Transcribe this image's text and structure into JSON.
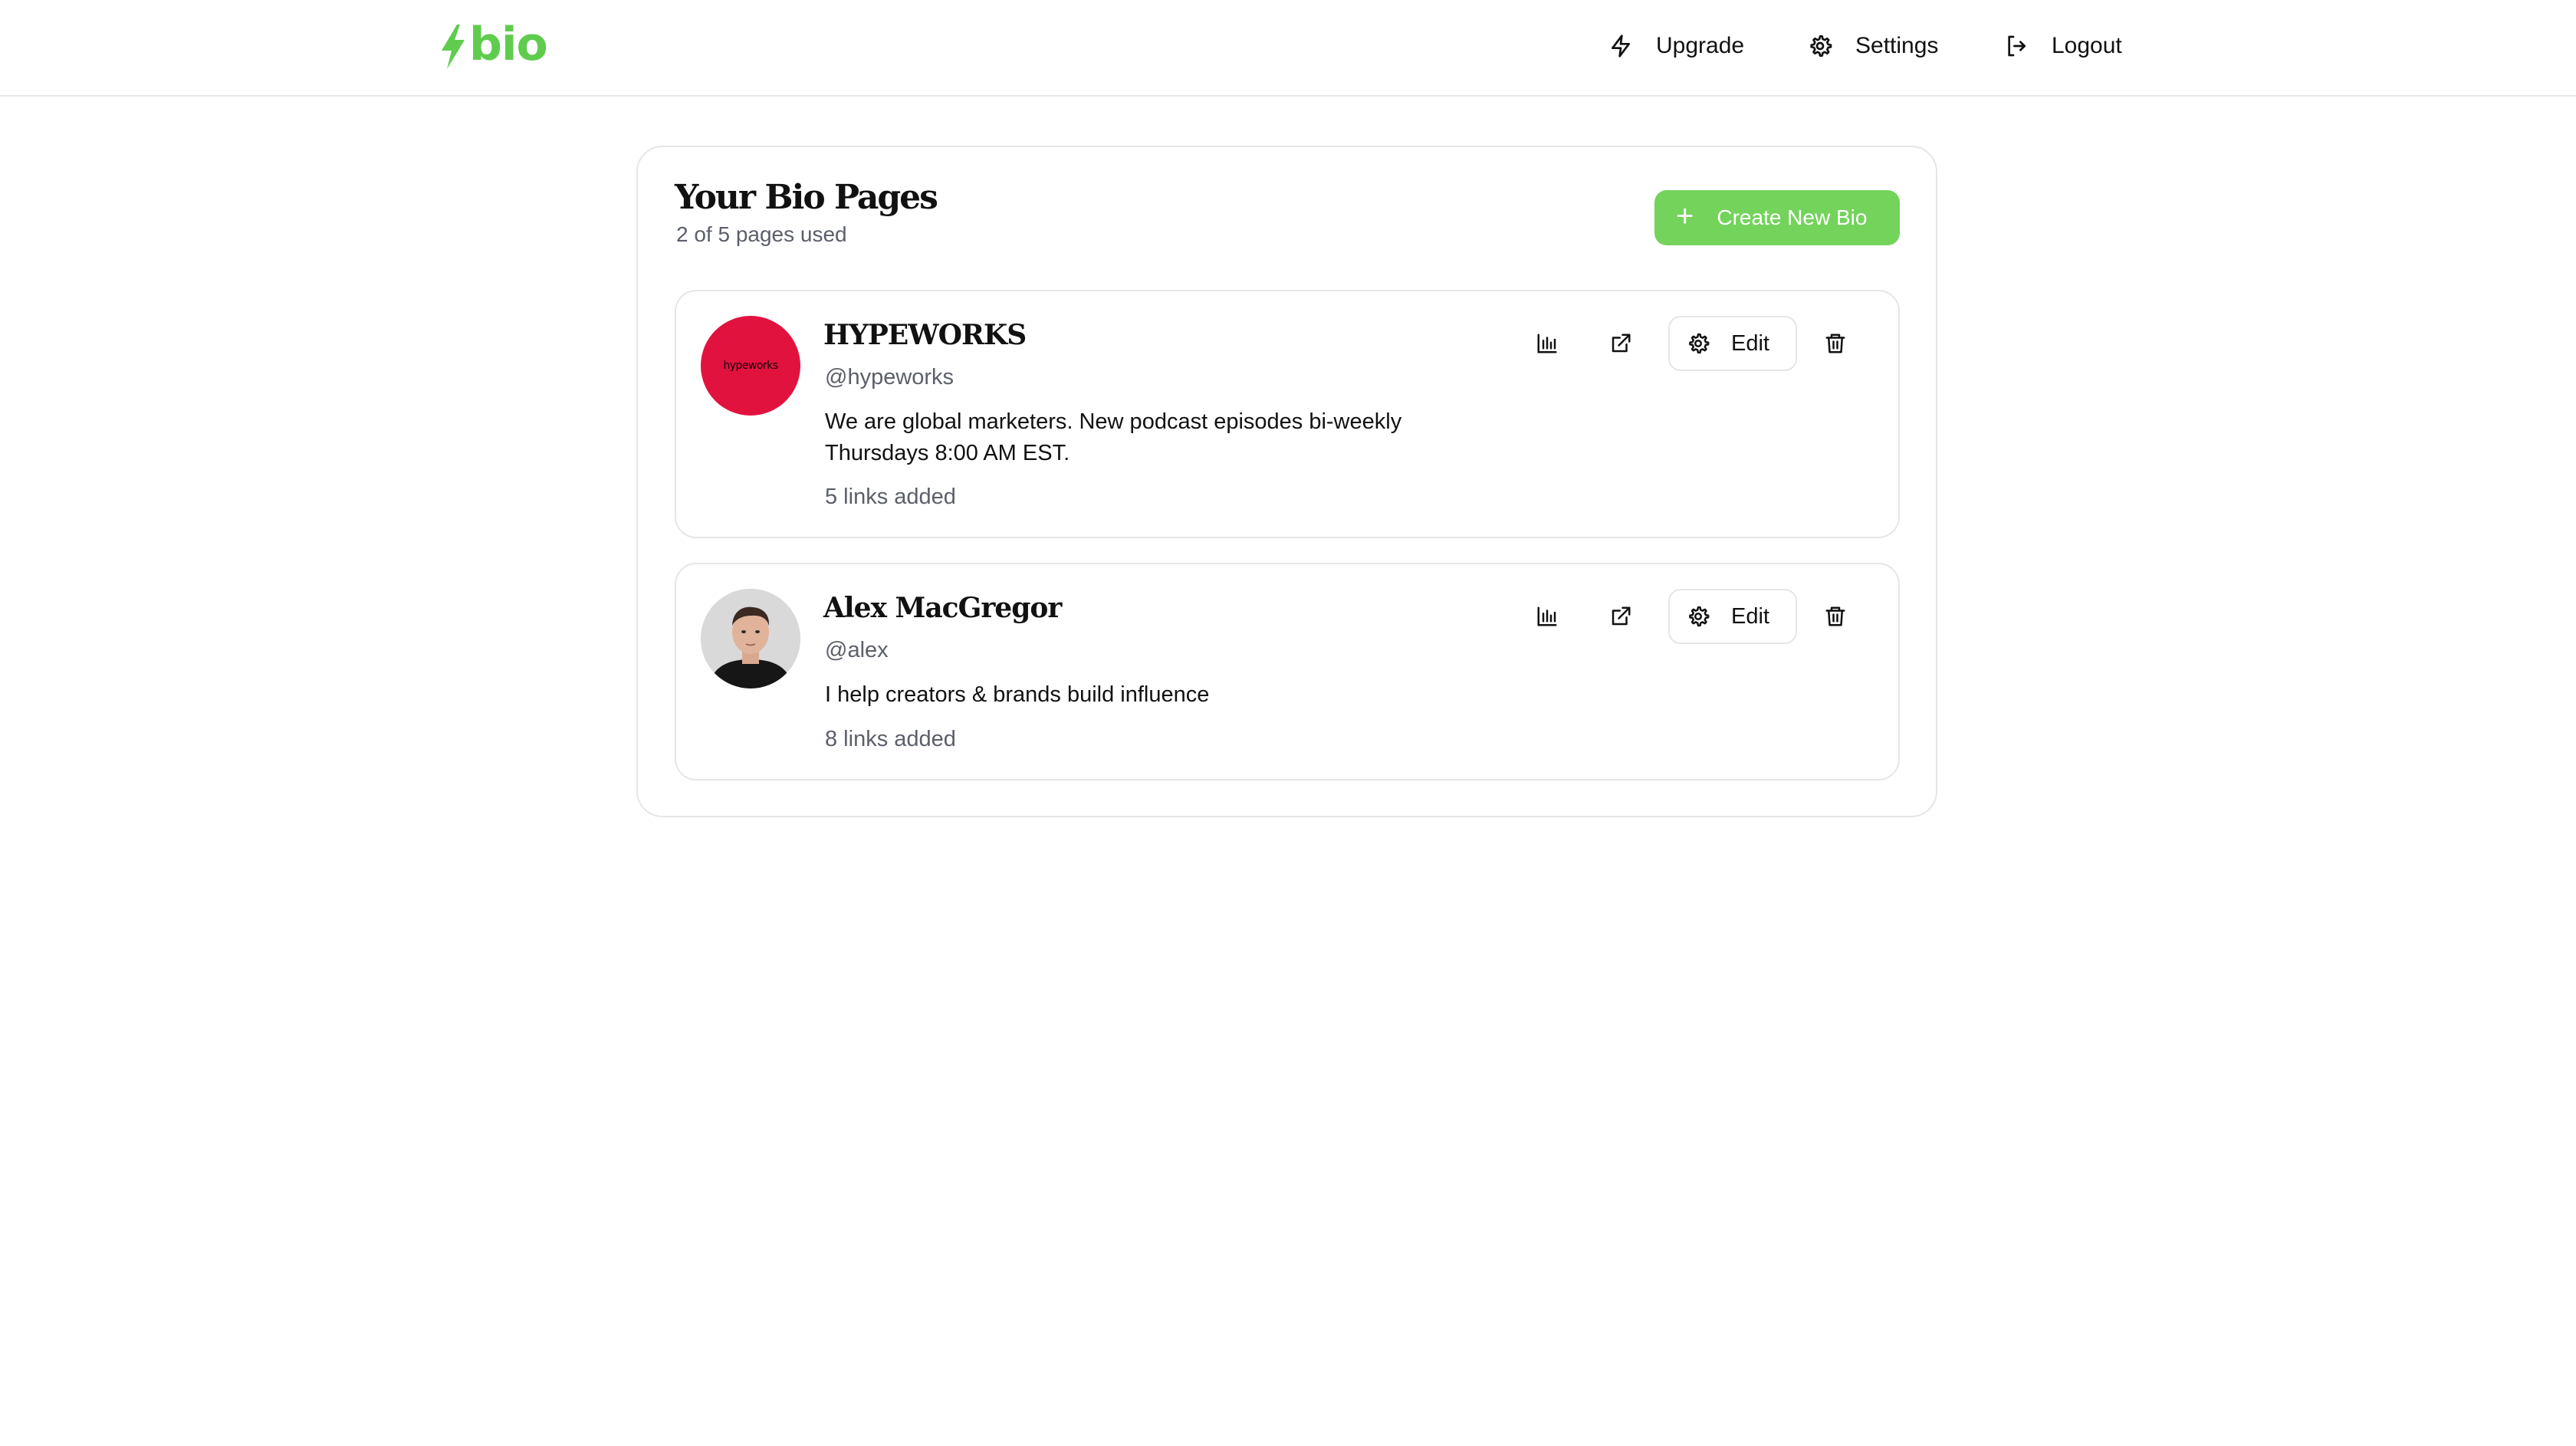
{
  "brand": {
    "logo_text": "bio",
    "accent_color": "#5fcc4e"
  },
  "nav": {
    "upgrade": {
      "label": "Upgrade",
      "icon": "lightning-icon"
    },
    "settings": {
      "label": "Settings",
      "icon": "gear-icon"
    },
    "logout": {
      "label": "Logout",
      "icon": "logout-icon"
    }
  },
  "panel": {
    "title": "Your Bio Pages",
    "subtitle": "2 of 5 pages used",
    "create_button": {
      "label": "Create New Bio",
      "icon": "plus-icon",
      "color": "#73d35b"
    }
  },
  "bios": [
    {
      "name": "HYPEWORKS",
      "handle": "@hypeworks",
      "description": "We are global marketers. New podcast episodes bi-weekly Thursdays 8:00 AM EST.",
      "links": "5 links added",
      "avatar_text": "hypeworks",
      "avatar_color": "#e2123f",
      "edit_label": "Edit"
    },
    {
      "name": "Alex MacGregor",
      "handle": "@alex",
      "description": "I help creators & brands build influence",
      "links": "8 links added",
      "avatar_text": "",
      "avatar_color": "#d6d6d6",
      "edit_label": "Edit"
    }
  ],
  "icons": {
    "stats": "bar-chart-icon",
    "open": "external-link-icon",
    "edit": "gear-icon",
    "delete": "trash-icon"
  }
}
